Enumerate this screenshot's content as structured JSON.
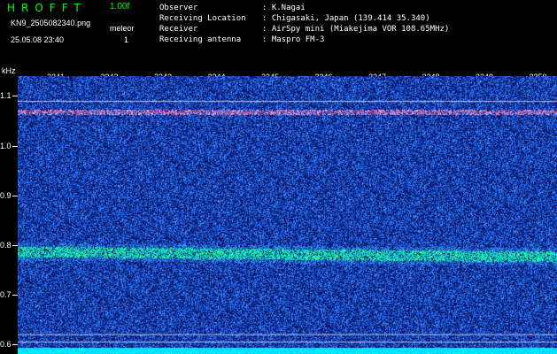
{
  "header": {
    "logo": "HROFFT",
    "version": "1.00f",
    "file_name": "KN9_2505082340.png",
    "mode": "meleor",
    "count": "1",
    "datetime": "25.05.08 23:40"
  },
  "info": [
    {
      "key": "Observer",
      "value": ": K.Nagai"
    },
    {
      "key": "Receiving Location",
      "value": ": Chigasaki, Japan (139.414 35.340)"
    },
    {
      "key": "Receiver",
      "value": ": AirSpy mini (Miakejima VOR 108.65MHz)"
    },
    {
      "key": "Receiving antenna",
      "value": ": Maspro FM-3"
    }
  ],
  "chart_data": {
    "type": "heatmap",
    "ylabel": "kHz",
    "y_ticks": [
      "1.1",
      "1.0",
      "0.9",
      "0.8",
      "0.7",
      "0.6"
    ],
    "x_ticks": [
      "2341",
      "2342",
      "2343",
      "2344",
      "2345",
      "2346",
      "2347",
      "2348",
      "2349",
      "2350"
    ],
    "ylim": [
      0.58,
      1.14
    ],
    "signal_lines_khz": [
      1.068,
      0.785,
      0.62,
      0.605
    ],
    "colors": {
      "background": "#0a1a6e",
      "noise": "#2a4cd8",
      "strong": "#00ff88",
      "peak": "#ff4060",
      "floor": "#00e5ff"
    }
  }
}
